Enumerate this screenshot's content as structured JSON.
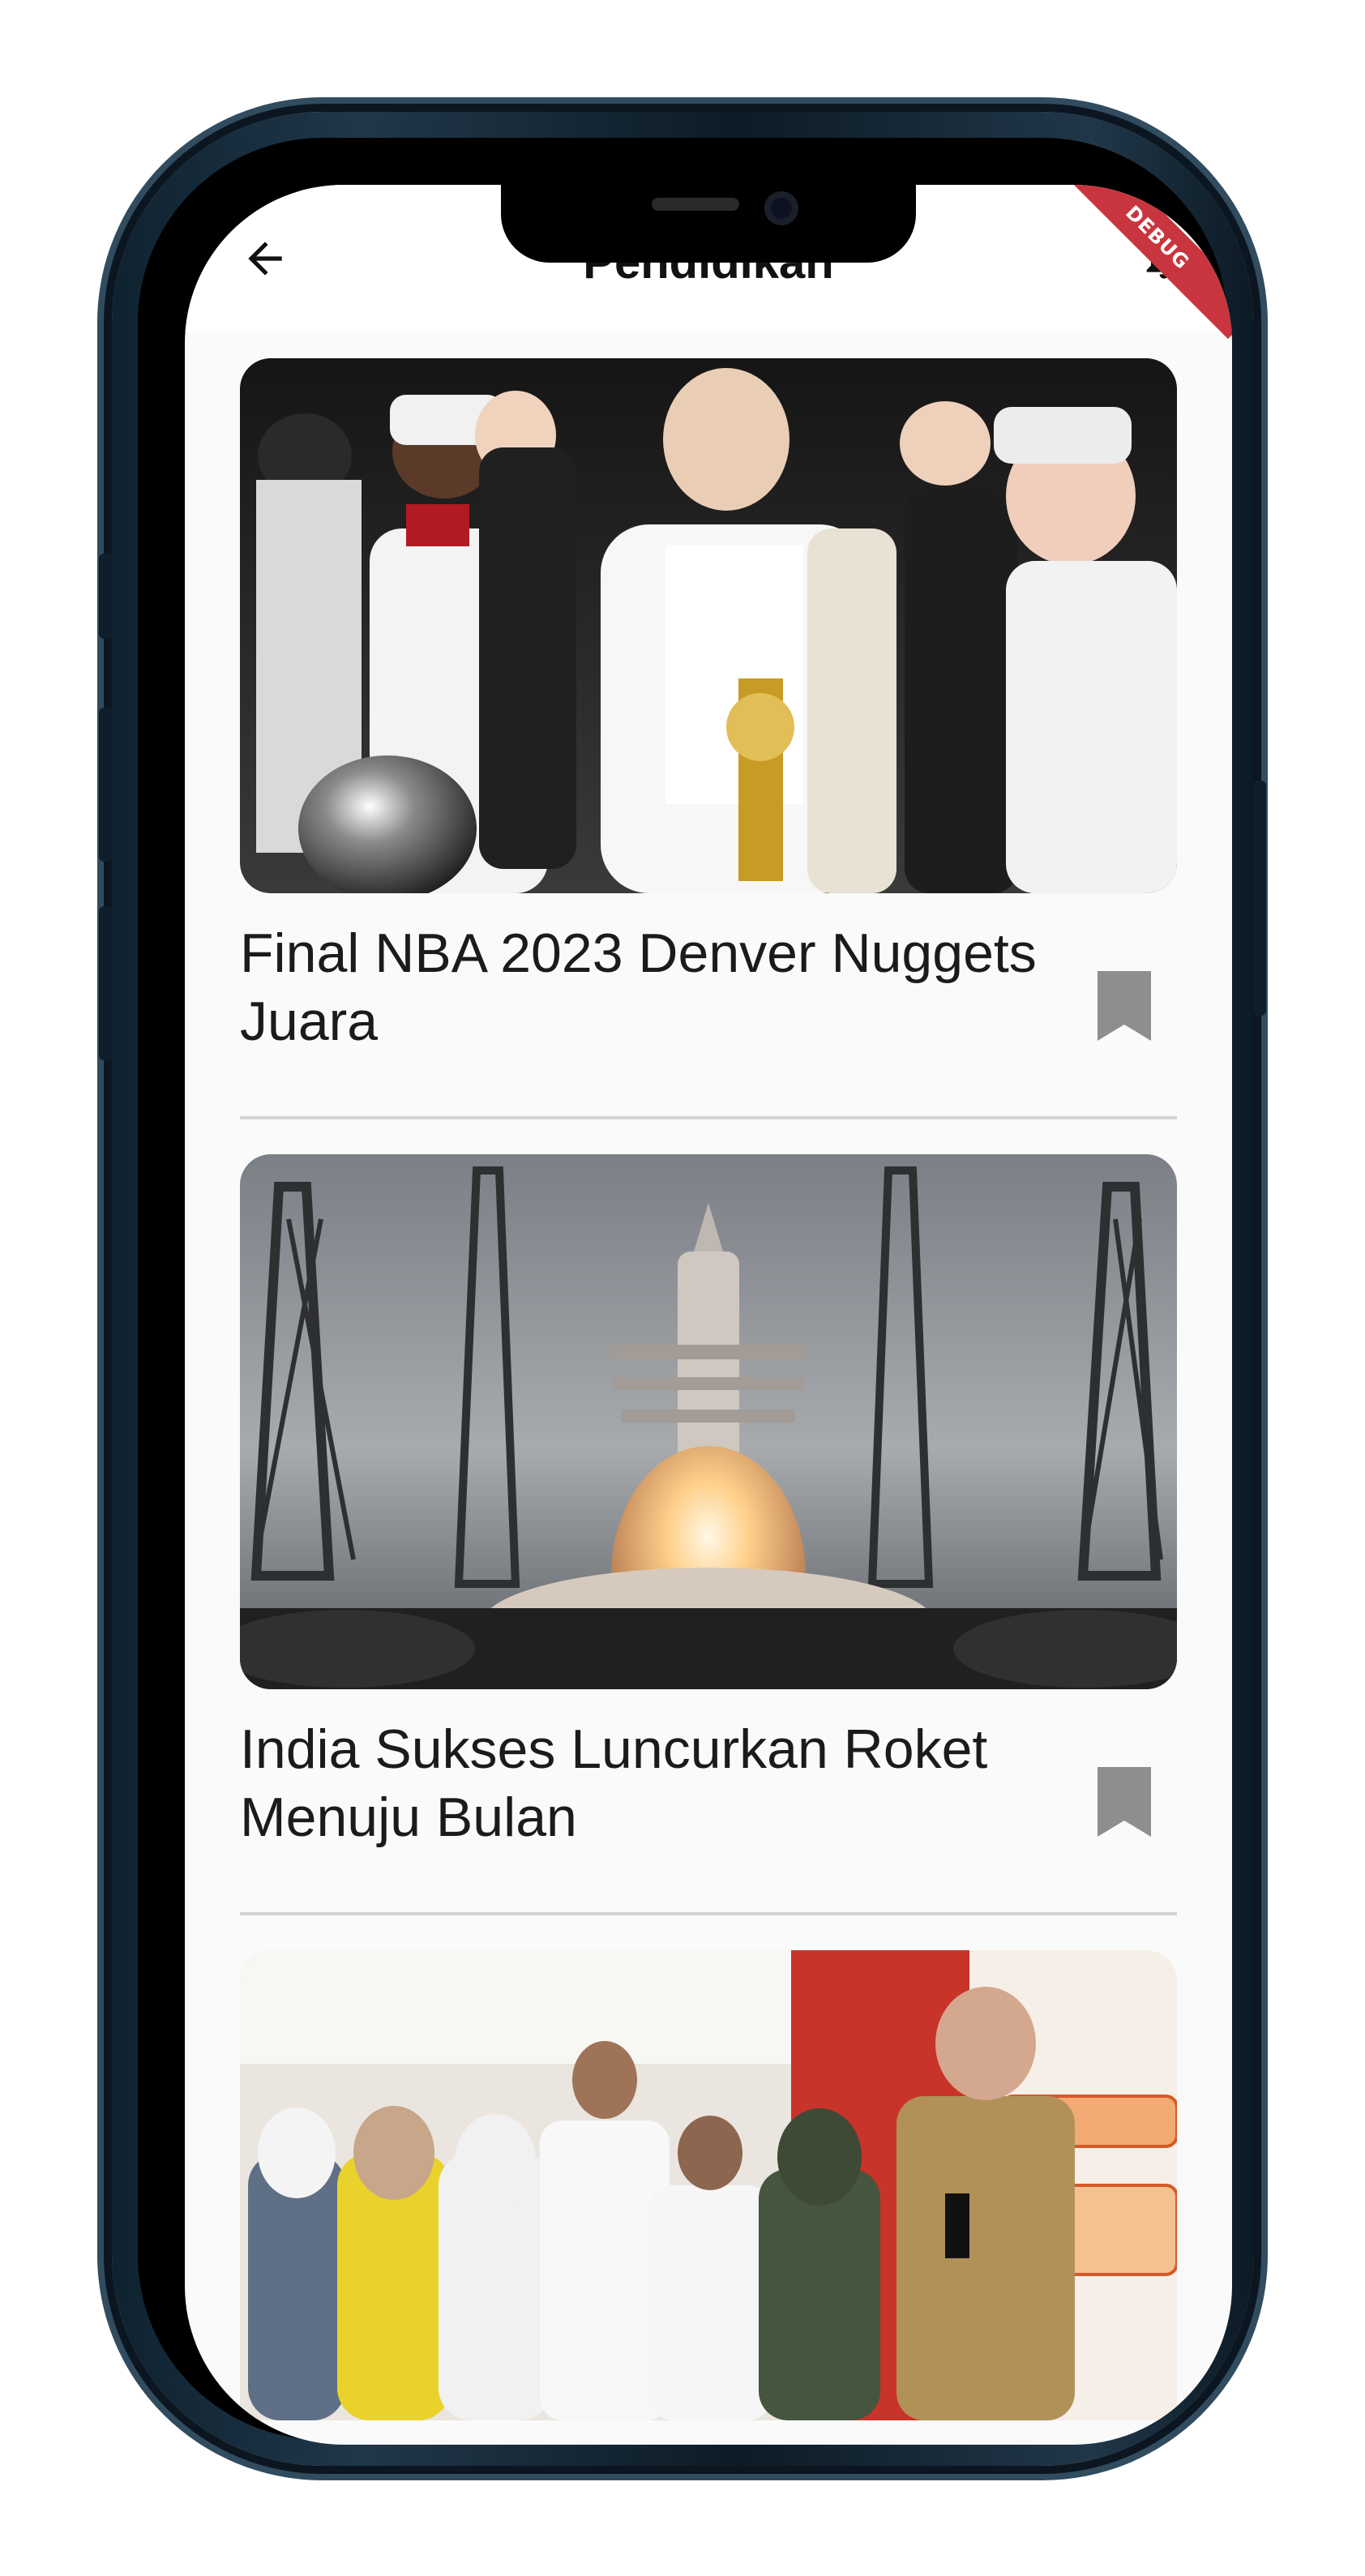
{
  "appbar": {
    "title": "Pendidikan",
    "back_icon": "arrow-left-icon",
    "right_icon": "notification-bell-icon"
  },
  "debug_banner": "DEBUG",
  "articles": [
    {
      "title": "Final NBA 2023 Denver Nuggets Juara",
      "image": "basketball-championship-photo",
      "bookmark_icon": "bookmark-icon"
    },
    {
      "title": "India Sukses Luncurkan Roket Menuju Bulan",
      "image": "rocket-launch-photo",
      "bookmark_icon": "bookmark-icon"
    },
    {
      "title": "",
      "image": "students-and-official-photo",
      "bookmark_icon": ""
    }
  ],
  "colors": {
    "debug": "#c9353e",
    "text": "#1b1b1b",
    "bookmark": "#8e8e8e",
    "divider": "#d4d4d4"
  }
}
